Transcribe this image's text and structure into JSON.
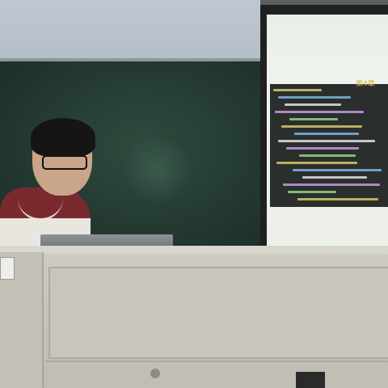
{
  "photo": {
    "subject": "",
    "slide": {
      "title_text": "第4章",
      "code_line_colors": [
        "#d6c56a",
        "#7fb3e0",
        "#e0e0e0",
        "#c49adf",
        "#8fd18a"
      ]
    },
    "colors": {
      "chalkboard": "#243a31",
      "shirt": "#7a2a2f",
      "podium": "#c8c5bc",
      "screen": "#eef1ea"
    }
  }
}
